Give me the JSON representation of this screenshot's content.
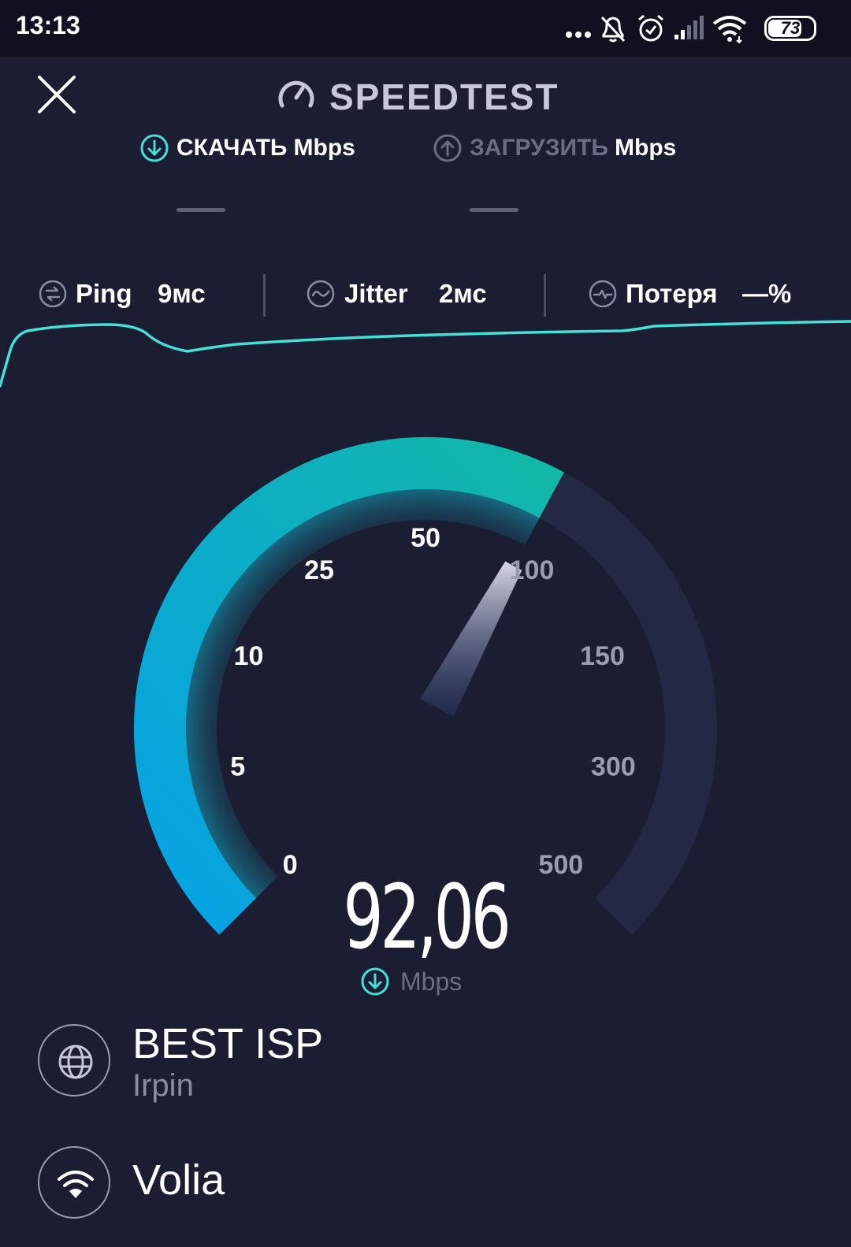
{
  "status_bar": {
    "time": "13:13",
    "battery": "73",
    "icons": [
      "more-dots-icon",
      "bell-off-icon",
      "alarm-icon",
      "cell-signal-icon",
      "wifi-icon",
      "battery-icon"
    ]
  },
  "header": {
    "title": "SPEEDTEST",
    "close_icon": "close-icon"
  },
  "tabs": [
    {
      "label": "СКАЧАТЬ",
      "unit": "Mbps",
      "icon": "download-arrow-icon",
      "active": true,
      "value": "—"
    },
    {
      "label": "ЗАГРУЗИТЬ",
      "unit": "Mbps",
      "icon": "upload-arrow-icon",
      "active": false,
      "value": "—"
    }
  ],
  "stats": {
    "ping": {
      "label": "Ping",
      "value": "9мс"
    },
    "jitter": {
      "label": "Jitter",
      "value": "2мс"
    },
    "loss": {
      "label": "Потеря",
      "value": "—%"
    }
  },
  "gauge": {
    "ticks": [
      "0",
      "5",
      "10",
      "25",
      "50",
      "100",
      "150",
      "300",
      "500"
    ],
    "current_value": 92.06
  },
  "result": {
    "value": "92,06",
    "unit": "Mbps"
  },
  "server": {
    "name": "BEST ISP",
    "location": "Irpin"
  },
  "network": {
    "name": "Volia"
  },
  "colors": {
    "background": "#1b1d33",
    "accent": "#45e0d6",
    "gauge_start": "#06a2e6",
    "gauge_end": "#12b8a8",
    "inactive": "#232844"
  }
}
